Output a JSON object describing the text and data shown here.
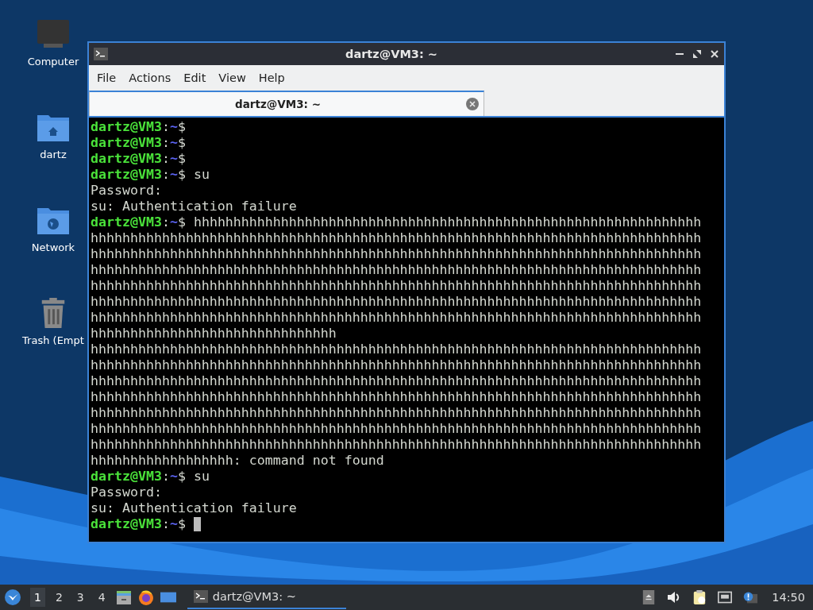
{
  "desktop_icons": [
    {
      "label": "Computer",
      "kind": "computer"
    },
    {
      "label": "dartz",
      "kind": "home"
    },
    {
      "label": "Network",
      "kind": "network"
    },
    {
      "label": "Trash (Empt",
      "kind": "trash"
    }
  ],
  "window": {
    "title": "dartz@VM3: ~",
    "menu": [
      "File",
      "Actions",
      "Edit",
      "View",
      "Help"
    ],
    "tabs": [
      {
        "label": "dartz@VM3: ~",
        "selected": true
      }
    ]
  },
  "terminal": {
    "lines": [
      {
        "kind": "prompt",
        "user": "dartz@VM3",
        "sep": ":",
        "path": "~",
        "symbol": "$",
        "cursor": false
      },
      {
        "kind": "prompt",
        "user": "dartz@VM3",
        "sep": ":",
        "path": "~",
        "symbol": "$",
        "cursor": false
      },
      {
        "kind": "prompt",
        "user": "dartz@VM3",
        "sep": ":",
        "path": "~",
        "symbol": "$",
        "cursor": false
      },
      {
        "kind": "prompt",
        "user": "dartz@VM3",
        "sep": ":",
        "path": "~",
        "symbol": "$",
        "command": "su",
        "cursor": false
      },
      {
        "kind": "output",
        "text": "Password:"
      },
      {
        "kind": "output",
        "text": "su: Authentication failure"
      },
      {
        "kind": "prompt",
        "user": "dartz@VM3",
        "sep": ":",
        "path": "~",
        "symbol": "$",
        "command": "hhhhhhhhhhhhhhhhhhhhhhhhhhhhhhhhhhhhhhhhhhhhhhhhhhhhhhhhhhhhhhhh",
        "cursor": false
      },
      {
        "kind": "output",
        "text": "hhhhhhhhhhhhhhhhhhhhhhhhhhhhhhhhhhhhhhhhhhhhhhhhhhhhhhhhhhhhhhhhhhhhhhhhhhhhh"
      },
      {
        "kind": "output",
        "text": "hhhhhhhhhhhhhhhhhhhhhhhhhhhhhhhhhhhhhhhhhhhhhhhhhhhhhhhhhhhhhhhhhhhhhhhhhhhhh"
      },
      {
        "kind": "output",
        "text": "hhhhhhhhhhhhhhhhhhhhhhhhhhhhhhhhhhhhhhhhhhhhhhhhhhhhhhhhhhhhhhhhhhhhhhhhhhhhh"
      },
      {
        "kind": "output",
        "text": "hhhhhhhhhhhhhhhhhhhhhhhhhhhhhhhhhhhhhhhhhhhhhhhhhhhhhhhhhhhhhhhhhhhhhhhhhhhhh"
      },
      {
        "kind": "output",
        "text": "hhhhhhhhhhhhhhhhhhhhhhhhhhhhhhhhhhhhhhhhhhhhhhhhhhhhhhhhhhhhhhhhhhhhhhhhhhhhh"
      },
      {
        "kind": "output",
        "text": "hhhhhhhhhhhhhhhhhhhhhhhhhhhhhhhhhhhhhhhhhhhhhhhhhhhhhhhhhhhhhhhhhhhhhhhhhhhhh"
      },
      {
        "kind": "output",
        "text": "hhhhhhhhhhhhhhhhhhhhhhhhhhhhhhh"
      },
      {
        "kind": "output",
        "text": "hhhhhhhhhhhhhhhhhhhhhhhhhhhhhhhhhhhhhhhhhhhhhhhhhhhhhhhhhhhhhhhhhhhhhhhhhhhhh"
      },
      {
        "kind": "output",
        "text": "hhhhhhhhhhhhhhhhhhhhhhhhhhhhhhhhhhhhhhhhhhhhhhhhhhhhhhhhhhhhhhhhhhhhhhhhhhhhh"
      },
      {
        "kind": "output",
        "text": "hhhhhhhhhhhhhhhhhhhhhhhhhhhhhhhhhhhhhhhhhhhhhhhhhhhhhhhhhhhhhhhhhhhhhhhhhhhhh"
      },
      {
        "kind": "output",
        "text": "hhhhhhhhhhhhhhhhhhhhhhhhhhhhhhhhhhhhhhhhhhhhhhhhhhhhhhhhhhhhhhhhhhhhhhhhhhhhh"
      },
      {
        "kind": "output",
        "text": "hhhhhhhhhhhhhhhhhhhhhhhhhhhhhhhhhhhhhhhhhhhhhhhhhhhhhhhhhhhhhhhhhhhhhhhhhhhhh"
      },
      {
        "kind": "output",
        "text": "hhhhhhhhhhhhhhhhhhhhhhhhhhhhhhhhhhhhhhhhhhhhhhhhhhhhhhhhhhhhhhhhhhhhhhhhhhhhh"
      },
      {
        "kind": "output",
        "text": "hhhhhhhhhhhhhhhhhhhhhhhhhhhhhhhhhhhhhhhhhhhhhhhhhhhhhhhhhhhhhhhhhhhhhhhhhhhhh"
      },
      {
        "kind": "output",
        "text": "hhhhhhhhhhhhhhhhhh: command not found"
      },
      {
        "kind": "prompt",
        "user": "dartz@VM3",
        "sep": ":",
        "path": "~",
        "symbol": "$",
        "command": "su",
        "cursor": false
      },
      {
        "kind": "output",
        "text": "Password:"
      },
      {
        "kind": "output",
        "text": "su: Authentication failure"
      },
      {
        "kind": "prompt",
        "user": "dartz@VM3",
        "sep": ":",
        "path": "~",
        "symbol": "$",
        "cursor": true
      }
    ]
  },
  "taskbar": {
    "workspaces": [
      {
        "label": "1",
        "selected": true
      },
      {
        "label": "2",
        "selected": false
      },
      {
        "label": "3",
        "selected": false
      },
      {
        "label": "4",
        "selected": false
      }
    ],
    "tasks": [
      {
        "label": "dartz@VM3: ~",
        "selected": true
      }
    ],
    "clock": "14:50"
  }
}
